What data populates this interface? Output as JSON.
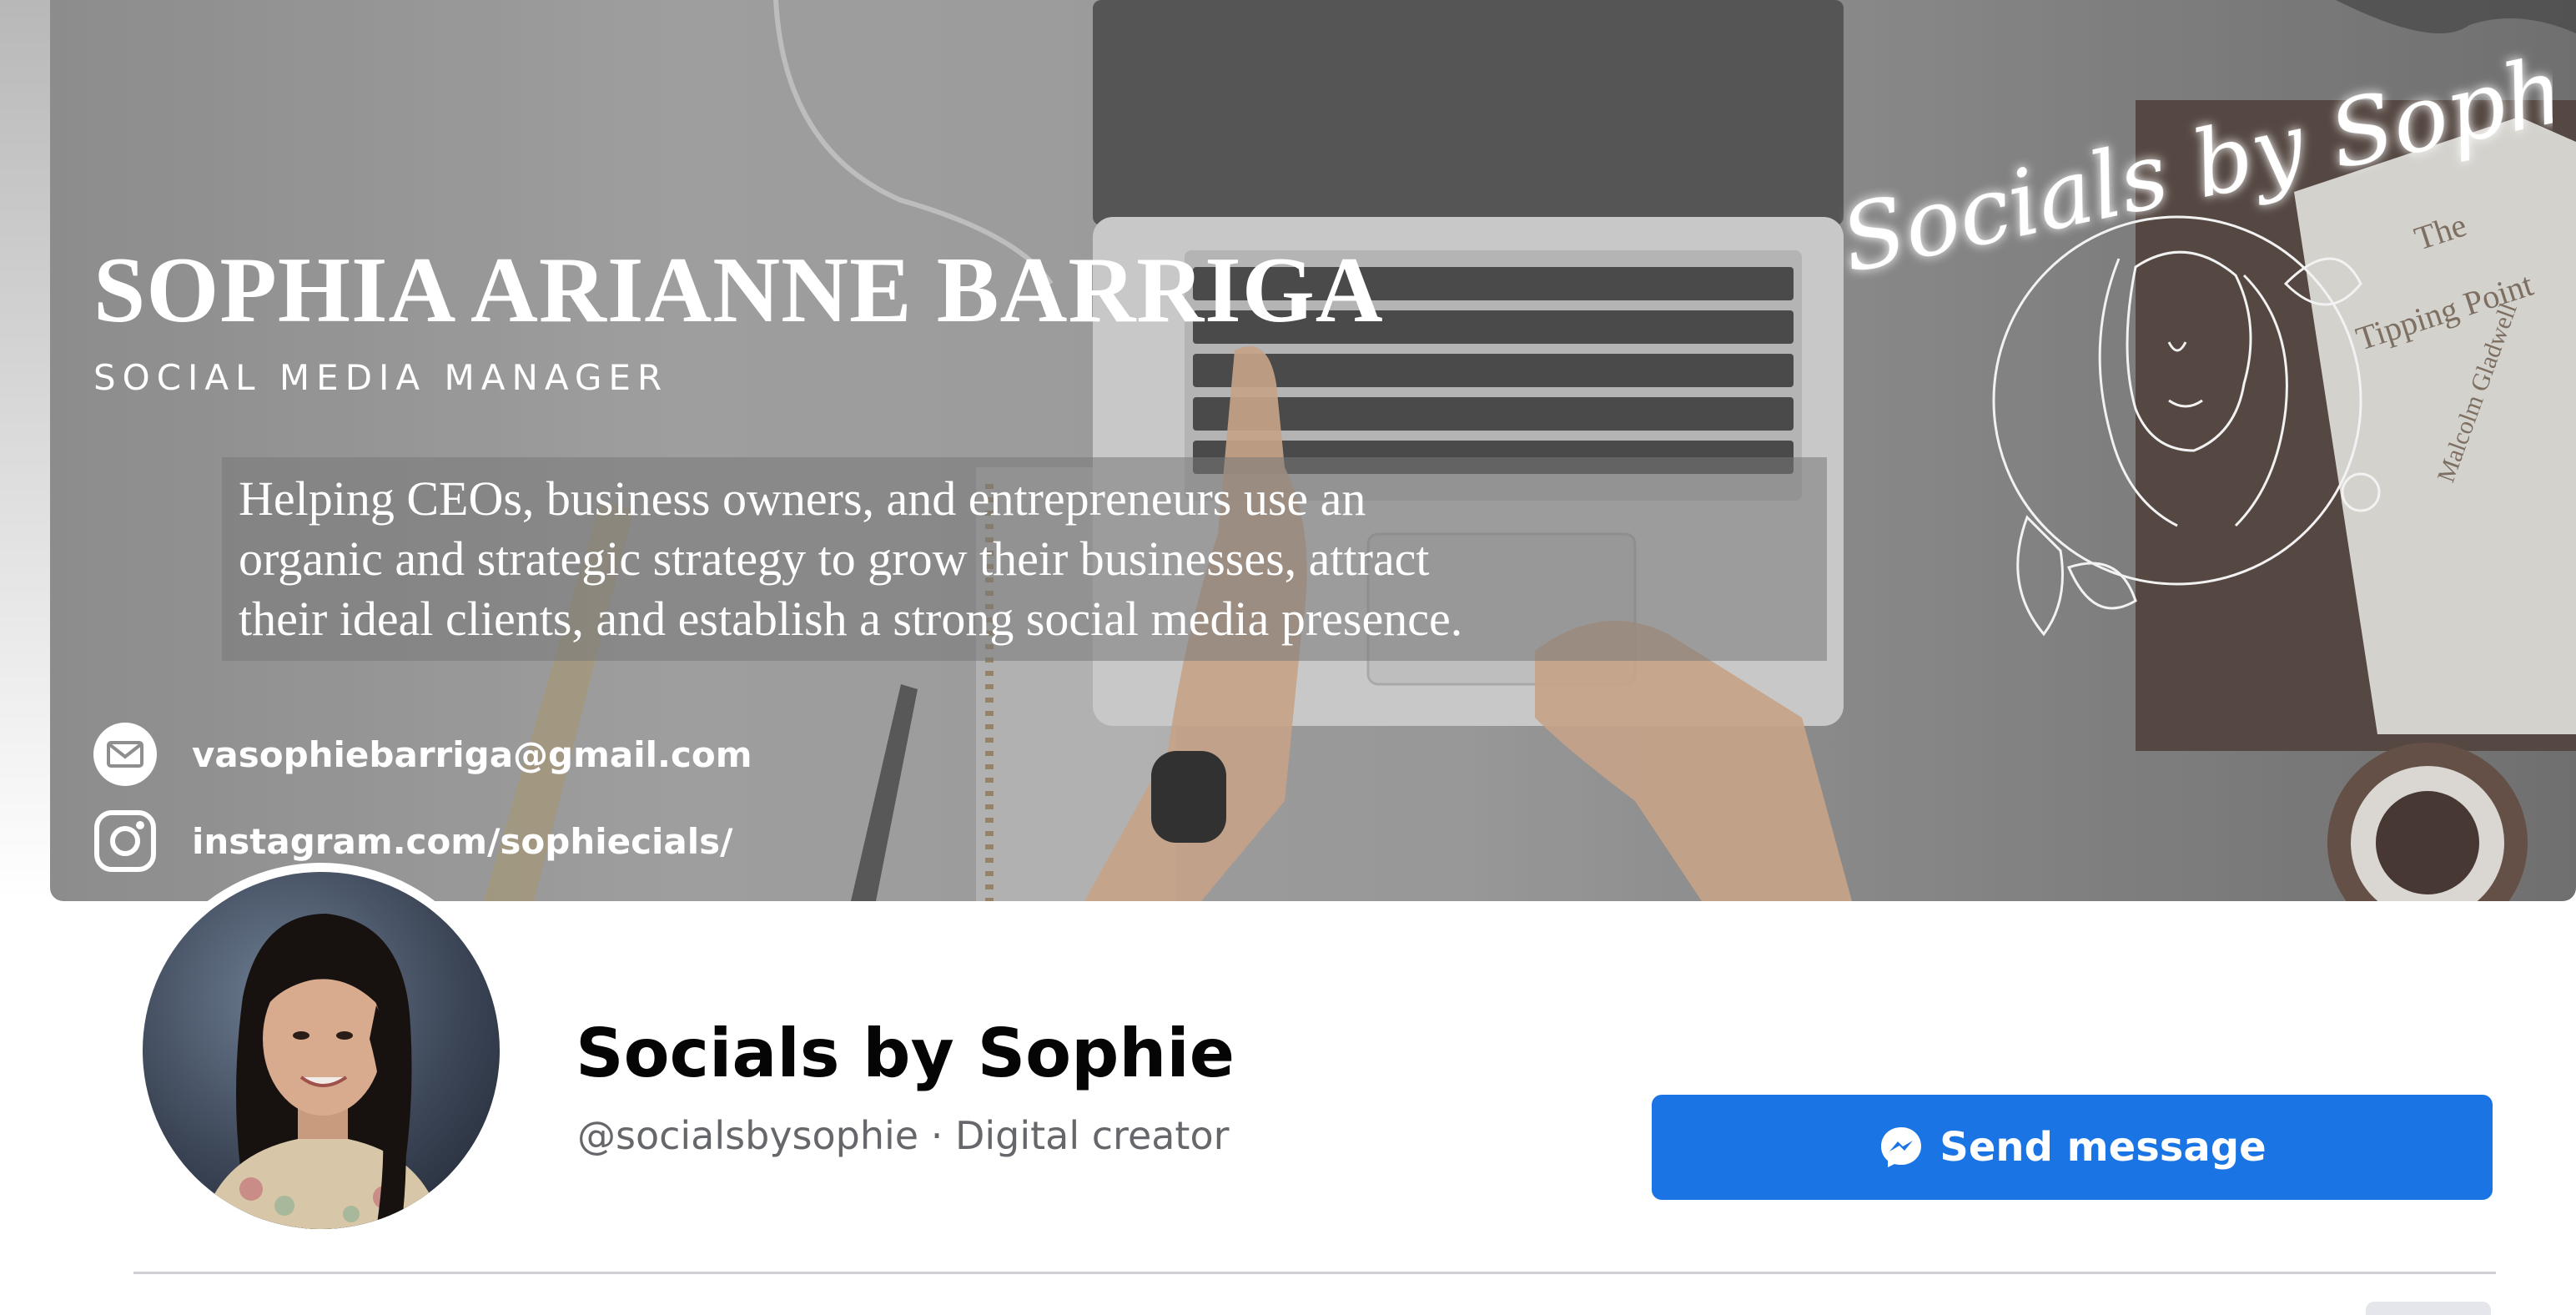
{
  "cover": {
    "name": "SOPHIA ARIANNE BARRIGA",
    "role": "SOCIAL MEDIA MANAGER",
    "tagline_lines": [
      "Helping CEOs, business owners, and entrepreneurs use an",
      "organic and strategic strategy to grow their businesses, attract",
      "their ideal clients, and establish a strong social media presence."
    ],
    "email": "vasophiebarriga@gmail.com",
    "instagram": "instagram.com/sophiecials/",
    "email_icon": "mail-icon",
    "instagram_icon": "instagram-icon",
    "brand_script": "Socials by Sophie",
    "book_title_lines": [
      "The",
      "Tipping Point"
    ],
    "book_author": "Malcolm Gladwell"
  },
  "profile": {
    "title": "Socials by Sophie",
    "subtitle": "@socialsbysophie · Digital creator",
    "send_button": {
      "label": "Send message",
      "icon": "messenger-icon",
      "color": "#1b74e4"
    }
  },
  "colors": {
    "title_text": "#050505",
    "subtitle_text": "#65676b",
    "divider": "#ced0d4"
  }
}
